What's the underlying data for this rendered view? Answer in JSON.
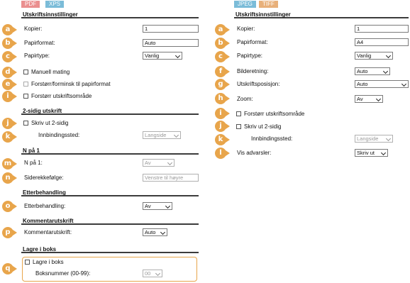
{
  "colors": {
    "badge": "#e8a54b",
    "pdf_tag": "#ea8f8f",
    "xps_tag": "#7bbcd8",
    "jpeg_tag": "#7bbcd8",
    "tiff_tag": "#e8b07a"
  },
  "tags": {
    "left": [
      "PDF",
      "XPS"
    ],
    "right": [
      "JPEG",
      "TIFF"
    ]
  },
  "left": {
    "header": "Utskriftsinnstillinger",
    "kopier_label": "Kopier:",
    "kopier_value": "1",
    "papirformat_label": "Papirformat:",
    "papirformat_value": "Auto",
    "papirtype_label": "Papirtype:",
    "papirtype_value": "Vanlig",
    "manuell_label": "Manuell mating",
    "forstorr_papir_label": "Forstørr/forminsk til papirformat",
    "forstorr_omr_label": "Forstørr utskriftsområde",
    "sec_2sidig": "2-sidig utskrift",
    "skriv2_label": "Skriv ut 2-sidig",
    "innbinding_label": "Innbindingssted:",
    "innbinding_value": "Langside",
    "sec_npa1": "N på 1",
    "npa1_label": "N på 1:",
    "npa1_value": "Av",
    "siderekke_label": "Siderekkefølge:",
    "siderekke_value": "Venstre til høyre",
    "sec_etter": "Etterbehandling",
    "etter_label": "Etterbehandling:",
    "etter_value": "Av",
    "sec_komm": "Kommentarutskrift",
    "komm_label": "Kommentarutskrift:",
    "komm_value": "Auto",
    "sec_lagre": "Lagre i boks",
    "lagre_label": "Lagre i boks",
    "boksnr_label": "Boksnummer (00-99):",
    "boksnr_value": "00"
  },
  "right": {
    "header": "Utskriftsinnstillinger",
    "kopier_label": "Kopier:",
    "kopier_value": "1",
    "papirformat_label": "Papirformat:",
    "papirformat_value": "A4",
    "papirtype_label": "Papirtype:",
    "papirtype_value": "Vanlig",
    "bilderetning_label": "Bilderetning:",
    "bilderetning_value": "Auto",
    "posisjon_label": "Utskriftsposisjon:",
    "posisjon_value": "Auto",
    "zoom_label": "Zoom:",
    "zoom_value": "Av",
    "forstorr_omr_label": "Forstørr utskriftsområde",
    "skriv2_label": "Skriv ut 2-sidig",
    "innbinding_label": "Innbindingssted:",
    "innbinding_value": "Langside",
    "advarsler_label": "Vis advarsler:",
    "advarsler_value": "Skriv ut"
  },
  "badges": {
    "left": [
      "a",
      "b",
      "c",
      "d",
      "e",
      "i",
      "j",
      "k",
      "m",
      "n",
      "o",
      "p",
      "q"
    ],
    "right": [
      "a",
      "b",
      "c",
      "f",
      "g",
      "h",
      "i",
      "j",
      "k",
      "l"
    ]
  }
}
